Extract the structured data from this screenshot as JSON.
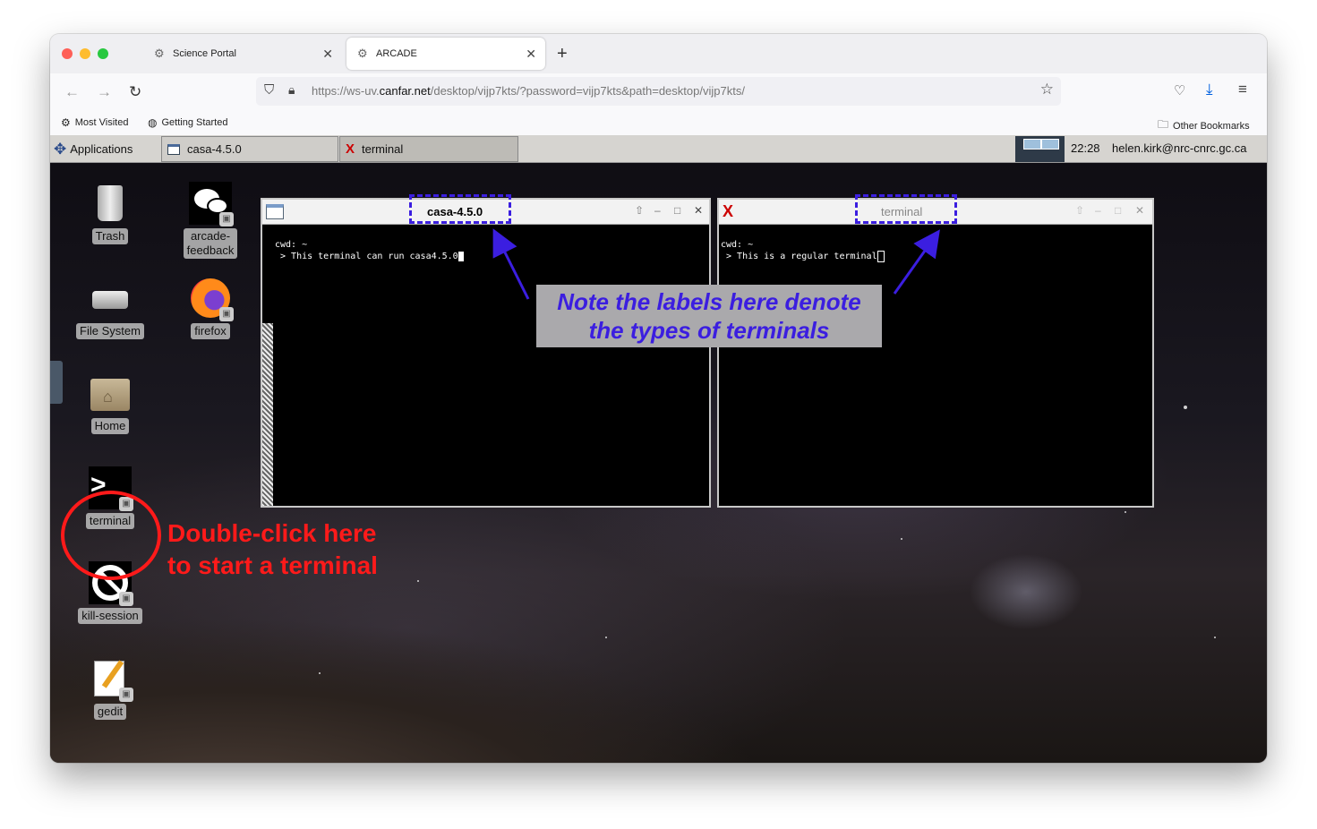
{
  "browser": {
    "tabs": [
      {
        "label": "Science Portal",
        "active": false
      },
      {
        "label": "ARCADE",
        "active": true
      }
    ],
    "url_prefix": "https://ws-uv.",
    "url_domain": "canfar.net",
    "url_path": "/desktop/vijp7kts/?password=vijp7kts&path=desktop/vijp7kts/",
    "bookmarks": [
      "Most Visited",
      "Getting Started"
    ],
    "other_bookmarks": "Other Bookmarks"
  },
  "panel": {
    "applications": "Applications",
    "tasks": [
      "casa-4.5.0",
      "terminal"
    ],
    "clock": "22:28",
    "user": "helen.kirk@nrc-cnrc.gc.ca"
  },
  "desktop_icons": {
    "trash": "Trash",
    "arcade_feedback_1": "arcade-",
    "arcade_feedback_2": "feedback",
    "file_system": "File System",
    "firefox": "firefox",
    "home": "Home",
    "terminal": "terminal",
    "kill_session": "kill-session",
    "gedit": "gedit"
  },
  "windows": {
    "casa": {
      "title": "casa-4.5.0",
      "line1": "cwd: ~",
      "line2": " > This terminal can run casa4.5.0"
    },
    "terminal": {
      "title": "terminal",
      "line1": "cwd: ~",
      "line2": " > This is a regular terminal"
    }
  },
  "annotations": {
    "note_line1": "Note the labels here denote",
    "note_line2": "the types of terminals",
    "red_line1": "Double-click here",
    "red_line2": "to start a terminal",
    "note_color": "#3b1ee0",
    "red_color": "#ff1a1a"
  }
}
